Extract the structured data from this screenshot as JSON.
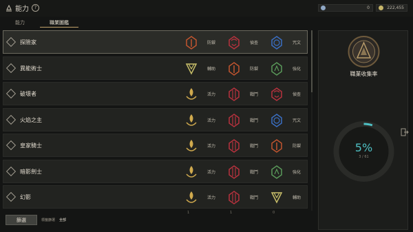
{
  "title": "能力",
  "help_glyph": "?",
  "tabs": [
    {
      "label": "能力"
    },
    {
      "label": "職業圖鑑"
    }
  ],
  "currency": [
    {
      "value": "0",
      "icon": "wings-icon",
      "color": "#8fa7c4"
    },
    {
      "value": "222,455",
      "icon": "coin-icon",
      "color": "#c7b66a"
    }
  ],
  "rows": [
    {
      "name": "探險家",
      "selected": true,
      "skills": [
        {
          "label": "防禦",
          "kind": "defense"
        },
        {
          "label": "偵查",
          "kind": "scout"
        },
        {
          "label": "咒文",
          "kind": "spell"
        }
      ]
    },
    {
      "name": "異能術士",
      "selected": false,
      "skills": [
        {
          "label": "輔助",
          "kind": "support"
        },
        {
          "label": "防禦",
          "kind": "defense"
        },
        {
          "label": "強化",
          "kind": "enhance"
        }
      ]
    },
    {
      "name": "破壞者",
      "selected": false,
      "skills": [
        {
          "label": "活力",
          "kind": "vitality"
        },
        {
          "label": "戰鬥",
          "kind": "combat"
        },
        {
          "label": "偵查",
          "kind": "scout"
        }
      ]
    },
    {
      "name": "火焰之主",
      "selected": false,
      "skills": [
        {
          "label": "活力",
          "kind": "vitality"
        },
        {
          "label": "戰鬥",
          "kind": "combat"
        },
        {
          "label": "咒文",
          "kind": "spell"
        }
      ]
    },
    {
      "name": "皇家騎士",
      "selected": false,
      "skills": [
        {
          "label": "活力",
          "kind": "vitality"
        },
        {
          "label": "戰鬥",
          "kind": "combat"
        },
        {
          "label": "防禦",
          "kind": "defense"
        }
      ]
    },
    {
      "name": "暗影劍士",
      "selected": false,
      "skills": [
        {
          "label": "活力",
          "kind": "vitality"
        },
        {
          "label": "戰鬥",
          "kind": "combat"
        },
        {
          "label": "強化",
          "kind": "enhance"
        }
      ]
    },
    {
      "name": "幻影",
      "selected": false,
      "skills": [
        {
          "label": "活力",
          "kind": "vitality"
        },
        {
          "label": "戰鬥",
          "kind": "combat"
        },
        {
          "label": "輔助",
          "kind": "support"
        }
      ]
    }
  ],
  "skill_colors": {
    "defense": "#c2552f",
    "scout": "#b8323e",
    "spell": "#3a6fc4",
    "support": "#c9c06a",
    "enhance": "#5a9a5a",
    "vitality": "#d0aa4e",
    "combat": "#b8323e"
  },
  "collection": {
    "title": "職業收集率",
    "percent_text": "5%",
    "count_text": "3 / 61",
    "progress": 0.05,
    "accent": "#4ec0c4"
  },
  "footer": {
    "filter_button": "篩選",
    "filter_label": "標籤篩選",
    "filter_value": "全部",
    "counts": [
      "1",
      "1",
      "0"
    ]
  }
}
